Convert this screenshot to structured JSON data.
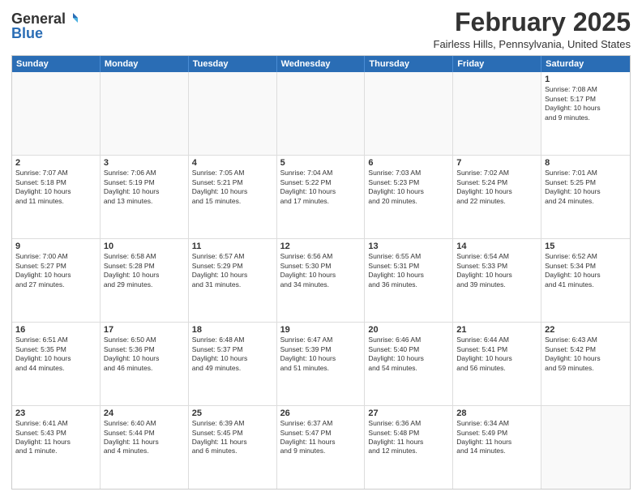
{
  "header": {
    "logo_general": "General",
    "logo_blue": "Blue",
    "month_title": "February 2025",
    "location": "Fairless Hills, Pennsylvania, United States"
  },
  "calendar": {
    "weekdays": [
      "Sunday",
      "Monday",
      "Tuesday",
      "Wednesday",
      "Thursday",
      "Friday",
      "Saturday"
    ],
    "rows": [
      [
        {
          "day": "",
          "info": ""
        },
        {
          "day": "",
          "info": ""
        },
        {
          "day": "",
          "info": ""
        },
        {
          "day": "",
          "info": ""
        },
        {
          "day": "",
          "info": ""
        },
        {
          "day": "",
          "info": ""
        },
        {
          "day": "1",
          "info": "Sunrise: 7:08 AM\nSunset: 5:17 PM\nDaylight: 10 hours\nand 9 minutes."
        }
      ],
      [
        {
          "day": "2",
          "info": "Sunrise: 7:07 AM\nSunset: 5:18 PM\nDaylight: 10 hours\nand 11 minutes."
        },
        {
          "day": "3",
          "info": "Sunrise: 7:06 AM\nSunset: 5:19 PM\nDaylight: 10 hours\nand 13 minutes."
        },
        {
          "day": "4",
          "info": "Sunrise: 7:05 AM\nSunset: 5:21 PM\nDaylight: 10 hours\nand 15 minutes."
        },
        {
          "day": "5",
          "info": "Sunrise: 7:04 AM\nSunset: 5:22 PM\nDaylight: 10 hours\nand 17 minutes."
        },
        {
          "day": "6",
          "info": "Sunrise: 7:03 AM\nSunset: 5:23 PM\nDaylight: 10 hours\nand 20 minutes."
        },
        {
          "day": "7",
          "info": "Sunrise: 7:02 AM\nSunset: 5:24 PM\nDaylight: 10 hours\nand 22 minutes."
        },
        {
          "day": "8",
          "info": "Sunrise: 7:01 AM\nSunset: 5:25 PM\nDaylight: 10 hours\nand 24 minutes."
        }
      ],
      [
        {
          "day": "9",
          "info": "Sunrise: 7:00 AM\nSunset: 5:27 PM\nDaylight: 10 hours\nand 27 minutes."
        },
        {
          "day": "10",
          "info": "Sunrise: 6:58 AM\nSunset: 5:28 PM\nDaylight: 10 hours\nand 29 minutes."
        },
        {
          "day": "11",
          "info": "Sunrise: 6:57 AM\nSunset: 5:29 PM\nDaylight: 10 hours\nand 31 minutes."
        },
        {
          "day": "12",
          "info": "Sunrise: 6:56 AM\nSunset: 5:30 PM\nDaylight: 10 hours\nand 34 minutes."
        },
        {
          "day": "13",
          "info": "Sunrise: 6:55 AM\nSunset: 5:31 PM\nDaylight: 10 hours\nand 36 minutes."
        },
        {
          "day": "14",
          "info": "Sunrise: 6:54 AM\nSunset: 5:33 PM\nDaylight: 10 hours\nand 39 minutes."
        },
        {
          "day": "15",
          "info": "Sunrise: 6:52 AM\nSunset: 5:34 PM\nDaylight: 10 hours\nand 41 minutes."
        }
      ],
      [
        {
          "day": "16",
          "info": "Sunrise: 6:51 AM\nSunset: 5:35 PM\nDaylight: 10 hours\nand 44 minutes."
        },
        {
          "day": "17",
          "info": "Sunrise: 6:50 AM\nSunset: 5:36 PM\nDaylight: 10 hours\nand 46 minutes."
        },
        {
          "day": "18",
          "info": "Sunrise: 6:48 AM\nSunset: 5:37 PM\nDaylight: 10 hours\nand 49 minutes."
        },
        {
          "day": "19",
          "info": "Sunrise: 6:47 AM\nSunset: 5:39 PM\nDaylight: 10 hours\nand 51 minutes."
        },
        {
          "day": "20",
          "info": "Sunrise: 6:46 AM\nSunset: 5:40 PM\nDaylight: 10 hours\nand 54 minutes."
        },
        {
          "day": "21",
          "info": "Sunrise: 6:44 AM\nSunset: 5:41 PM\nDaylight: 10 hours\nand 56 minutes."
        },
        {
          "day": "22",
          "info": "Sunrise: 6:43 AM\nSunset: 5:42 PM\nDaylight: 10 hours\nand 59 minutes."
        }
      ],
      [
        {
          "day": "23",
          "info": "Sunrise: 6:41 AM\nSunset: 5:43 PM\nDaylight: 11 hours\nand 1 minute."
        },
        {
          "day": "24",
          "info": "Sunrise: 6:40 AM\nSunset: 5:44 PM\nDaylight: 11 hours\nand 4 minutes."
        },
        {
          "day": "25",
          "info": "Sunrise: 6:39 AM\nSunset: 5:45 PM\nDaylight: 11 hours\nand 6 minutes."
        },
        {
          "day": "26",
          "info": "Sunrise: 6:37 AM\nSunset: 5:47 PM\nDaylight: 11 hours\nand 9 minutes."
        },
        {
          "day": "27",
          "info": "Sunrise: 6:36 AM\nSunset: 5:48 PM\nDaylight: 11 hours\nand 12 minutes."
        },
        {
          "day": "28",
          "info": "Sunrise: 6:34 AM\nSunset: 5:49 PM\nDaylight: 11 hours\nand 14 minutes."
        },
        {
          "day": "",
          "info": ""
        }
      ]
    ]
  }
}
